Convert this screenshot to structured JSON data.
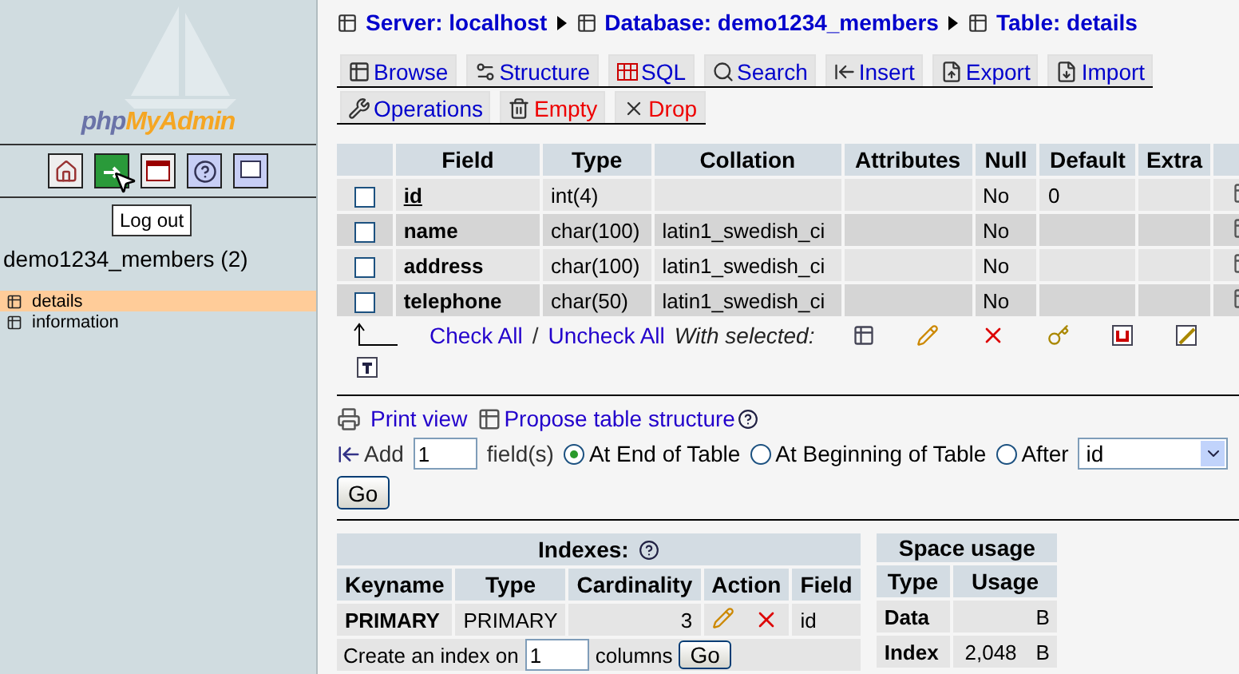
{
  "sidebar": {
    "logo": {
      "part1": "php",
      "part2": "MyAdmin"
    },
    "tooltip": "Log out",
    "database": "demo1234_members (2)",
    "tables": [
      {
        "name": "details",
        "selected": true
      },
      {
        "name": "information",
        "selected": false
      }
    ]
  },
  "breadcrumb": [
    {
      "label": "Server: localhost"
    },
    {
      "label": "Database: demo1234_members"
    },
    {
      "label": "Table: details"
    }
  ],
  "tabs": [
    [
      {
        "label": "Browse",
        "kind": "normal",
        "selected": false
      },
      {
        "label": "Structure",
        "kind": "normal",
        "selected": false
      },
      {
        "label": "SQL",
        "kind": "normal",
        "selected": false
      },
      {
        "label": "Search",
        "kind": "normal",
        "selected": false
      },
      {
        "label": "Insert",
        "kind": "normal",
        "selected": false
      },
      {
        "label": "Export",
        "kind": "normal",
        "selected": false
      },
      {
        "label": "Import",
        "kind": "normal",
        "selected": false
      }
    ],
    [
      {
        "label": "Operations",
        "kind": "normal",
        "selected": false
      },
      {
        "label": "Empty",
        "kind": "danger",
        "selected": false
      },
      {
        "label": "Drop",
        "kind": "danger",
        "selected": false
      }
    ]
  ],
  "structure": {
    "columns": [
      "Field",
      "Type",
      "Collation",
      "Attributes",
      "Null",
      "Default",
      "Extra"
    ],
    "rows": [
      {
        "checked": false,
        "primary": true,
        "cells": [
          "id",
          "int(4)",
          "",
          "",
          "No",
          "0",
          ""
        ]
      },
      {
        "checked": false,
        "primary": false,
        "cells": [
          "name",
          "char(100)",
          "latin1_swedish_ci",
          "",
          "No",
          "",
          ""
        ]
      },
      {
        "checked": false,
        "primary": false,
        "cells": [
          "address",
          "char(100)",
          "latin1_swedish_ci",
          "",
          "No",
          "",
          ""
        ]
      },
      {
        "checked": false,
        "primary": false,
        "cells": [
          "telephone",
          "char(50)",
          "latin1_swedish_ci",
          "",
          "No",
          "",
          ""
        ]
      }
    ],
    "check_all": "Check All",
    "separator": "/",
    "uncheck_all": "Uncheck All",
    "with_selected": "With selected:"
  },
  "links": {
    "print_view": "Print view",
    "propose": "Propose table structure"
  },
  "add_field": {
    "label": "Add",
    "value": "1",
    "unit": "field(s)",
    "positions": [
      {
        "label": "At End of Table",
        "selected": true
      },
      {
        "label": "At Beginning of Table",
        "selected": false
      },
      {
        "label": "After",
        "selected": false
      }
    ],
    "after_value": "id",
    "go": "Go"
  },
  "indexes": {
    "title": "Indexes:",
    "columns": [
      "Keyname",
      "Type",
      "Cardinality",
      "Action",
      "Field"
    ],
    "rows": [
      {
        "cells": [
          "PRIMARY",
          "PRIMARY",
          "3",
          "",
          "id"
        ]
      }
    ],
    "create_label": "Create an index on",
    "create_value": "1",
    "create_unit": "columns",
    "go": "Go"
  },
  "space_usage": {
    "title": "Space usage",
    "columns": [
      "Type",
      "Usage"
    ],
    "rows": [
      {
        "type": "Data",
        "unit": "B"
      },
      {
        "type": "Index",
        "value": "2,048",
        "unit": "B"
      }
    ]
  }
}
